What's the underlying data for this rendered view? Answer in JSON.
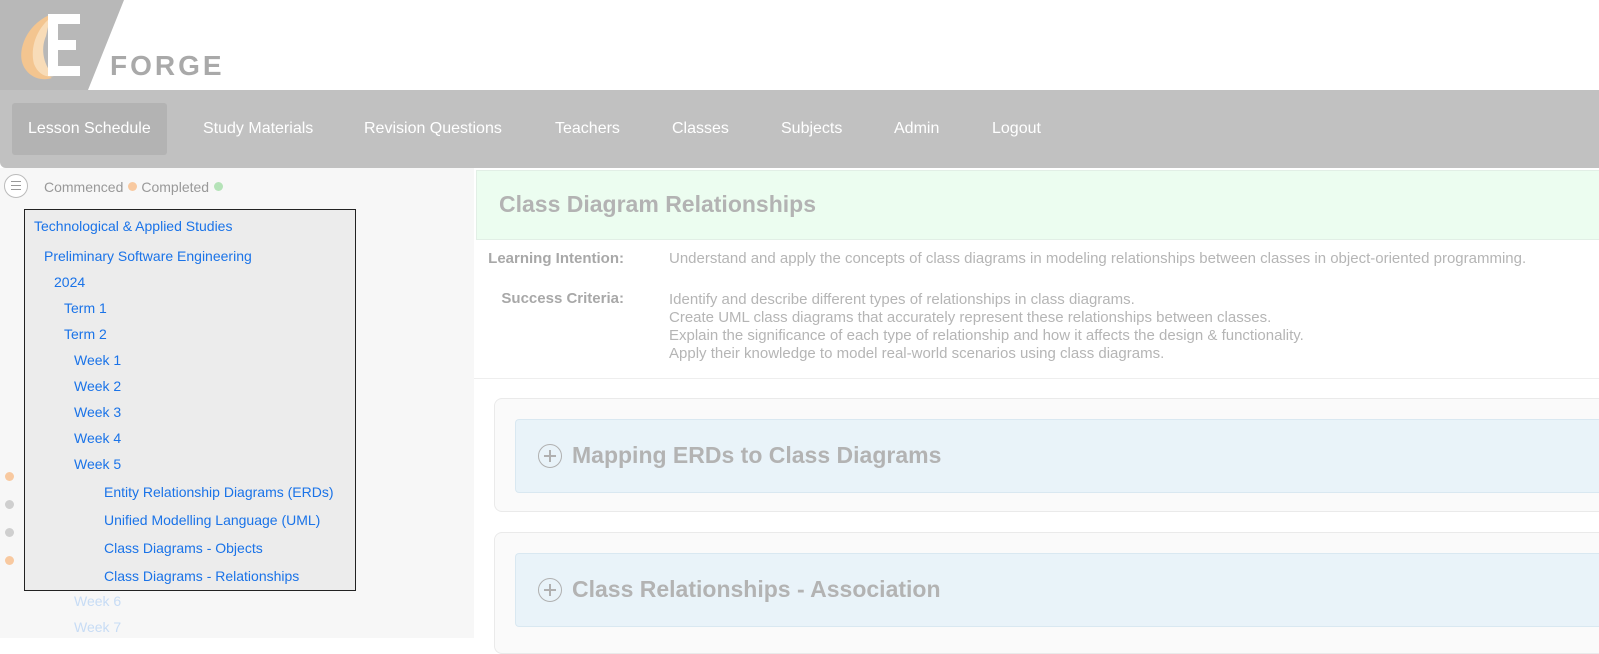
{
  "brand": {
    "name": "FORGE",
    "logo_letter": "E"
  },
  "nav": {
    "items": [
      {
        "label": "Lesson Schedule",
        "active": true
      },
      {
        "label": "Study Materials"
      },
      {
        "label": "Revision Questions"
      },
      {
        "label": "Teachers"
      },
      {
        "label": "Classes"
      },
      {
        "label": "Subjects"
      },
      {
        "label": "Admin"
      },
      {
        "label": "Logout"
      }
    ]
  },
  "legend": {
    "commenced": "Commenced",
    "completed": "Completed",
    "commenced_color": "#f8c9a0",
    "completed_color": "#b5e3b8"
  },
  "tree": {
    "faculty": "Technological & Applied Studies",
    "course": "Preliminary Software Engineering",
    "year": "2024",
    "term1": "Term 1",
    "term2": "Term 2",
    "weeks": [
      "Week 1",
      "Week 2",
      "Week 3",
      "Week 4",
      "Week 5"
    ],
    "lessons": [
      {
        "label": "Entity Relationship Diagrams (ERDs)",
        "status": "commenced"
      },
      {
        "label": "Unified Modelling Language (UML)",
        "status": "none"
      },
      {
        "label": "Class Diagrams - Objects",
        "status": "none"
      },
      {
        "label": "Class Diagrams - Relationships",
        "status": "commenced"
      }
    ],
    "faded_weeks": [
      "Week 6",
      "Week 7"
    ]
  },
  "lesson": {
    "title": "Class Diagram Relationships",
    "learning_intention_label": "Learning Intention:",
    "learning_intention": "Understand and apply the concepts of class diagrams in modeling relationships between classes in object-oriented programming.",
    "success_criteria_label": "Success Criteria:",
    "success_criteria": [
      "Identify and describe different types of relationships in class diagrams.",
      "Create UML class diagrams that accurately represent these relationships between classes.",
      "Explain the significance of each type of relationship and how it affects the design & functionality.",
      "Apply their knowledge to model real-world scenarios using class diagrams."
    ]
  },
  "sections": [
    {
      "title": "Mapping ERDs to Class Diagrams"
    },
    {
      "title": "Class Relationships - Association"
    }
  ]
}
